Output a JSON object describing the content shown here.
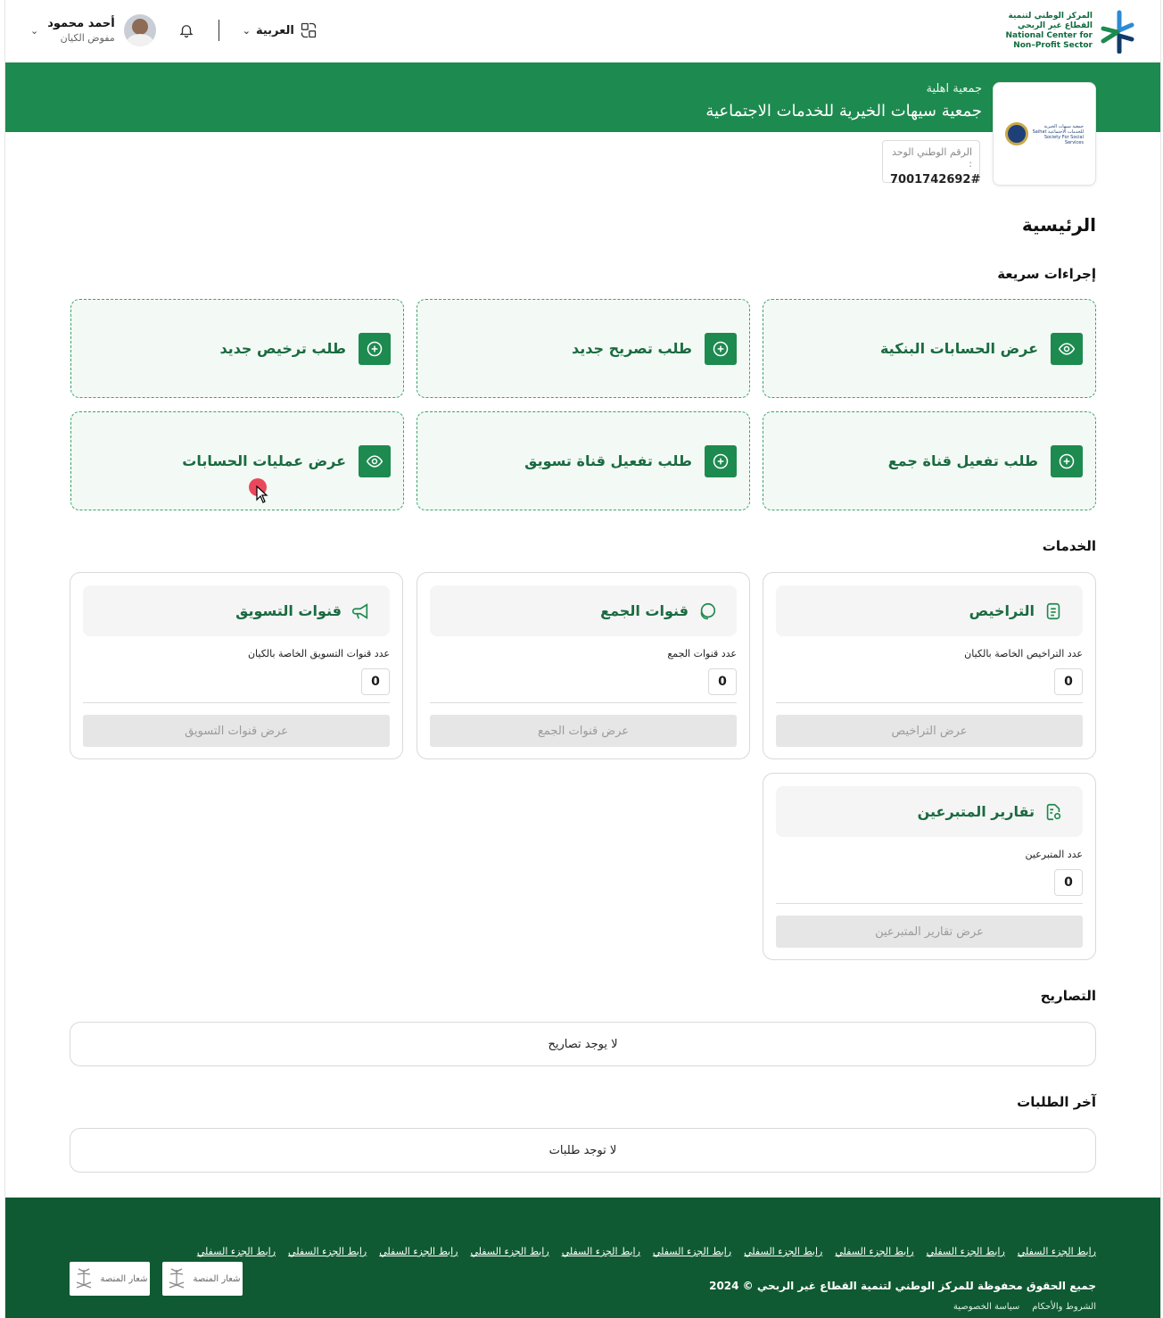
{
  "brand": {
    "name_ar_line1": "المركز الوطني لتنمية",
    "name_ar_line2": "القطاع غير الربحي",
    "name_en_line1": "National Center for",
    "name_en_line2": "Non–Profit Sector",
    "colors": {
      "primary": "#1d8a4f",
      "dark": "#0f5a32",
      "accent_blue": "#2a8bd6"
    }
  },
  "header": {
    "user_name": "أحمد محمود",
    "user_role": "مفوض الكيان",
    "language": "العربية"
  },
  "entity": {
    "type": "جمعية اهلية",
    "name": "جمعية سيهات الخيرية للخدمات الاجتماعية",
    "logo_text": "جمعية سيهات الخيرية للخدمات الاجتماعية Saihat Society For Social Services",
    "national_id_label": "الرقم الوطني الوحد :",
    "national_id": "7001742692#"
  },
  "page_title": "الرئيسية",
  "quick_actions": {
    "title": "إجراءات سريعة",
    "items": [
      {
        "label": "عرض الحسابات البنكية",
        "icon": "eye-icon"
      },
      {
        "label": "طلب تصريح جديد",
        "icon": "plus-circle-icon"
      },
      {
        "label": "طلب ترخيص جديد",
        "icon": "plus-circle-icon"
      },
      {
        "label": "طلب تفعيل قناة جمع",
        "icon": "plus-circle-icon"
      },
      {
        "label": "طلب تفعيل قناة تسويق",
        "icon": "plus-circle-icon"
      },
      {
        "label": "عرض عمليات الحسابات",
        "icon": "eye-icon"
      }
    ]
  },
  "services": {
    "title": "الخدمات",
    "items": [
      {
        "title": "التراخيص",
        "icon": "document-list-icon",
        "count_label": "عدد التراخيص الخاصة بالكيان",
        "count": "0",
        "button": "عرض التراخيص"
      },
      {
        "title": "قنوات الجمع",
        "icon": "coins-icon",
        "count_label": "عدد قنوات الجمع",
        "count": "0",
        "button": "عرض قنوات الجمع"
      },
      {
        "title": "قنوات التسويق",
        "icon": "megaphone-icon",
        "count_label": "عدد قنوات التسويق الخاصة بالكيان",
        "count": "0",
        "button": "عرض قنوات التسويق"
      },
      {
        "title": "تقارير المتبرعين",
        "icon": "report-icon",
        "count_label": "عدد المتبرعين",
        "count": "0",
        "button": "عرض تقارير المتبرعين"
      }
    ]
  },
  "permits": {
    "title": "التصاريح",
    "empty": "لا يوجد تصاريح"
  },
  "requests": {
    "title": "آخر الطلبات",
    "empty": "لا توجد طلبات"
  },
  "footer": {
    "links": [
      "رابط الجزء السفلي",
      "رابط الجزء السفلي",
      "رابط الجزء السفلي",
      "رابط الجزء السفلي",
      "رابط الجزء السفلي",
      "رابط الجزء السفلي",
      "رابط الجزء السفلي",
      "رابط الجزء السفلي",
      "رابط الجزء السفلي",
      "رابط الجزء السفلي"
    ],
    "copyright": "جميع الحقوق محفوظة للمركز الوطني لتنمية القطاع غير الربحي © 2024",
    "terms": "الشروط والأحكام",
    "privacy": "سياسة الخصوصية",
    "badge_label": "شعار المنصة"
  }
}
